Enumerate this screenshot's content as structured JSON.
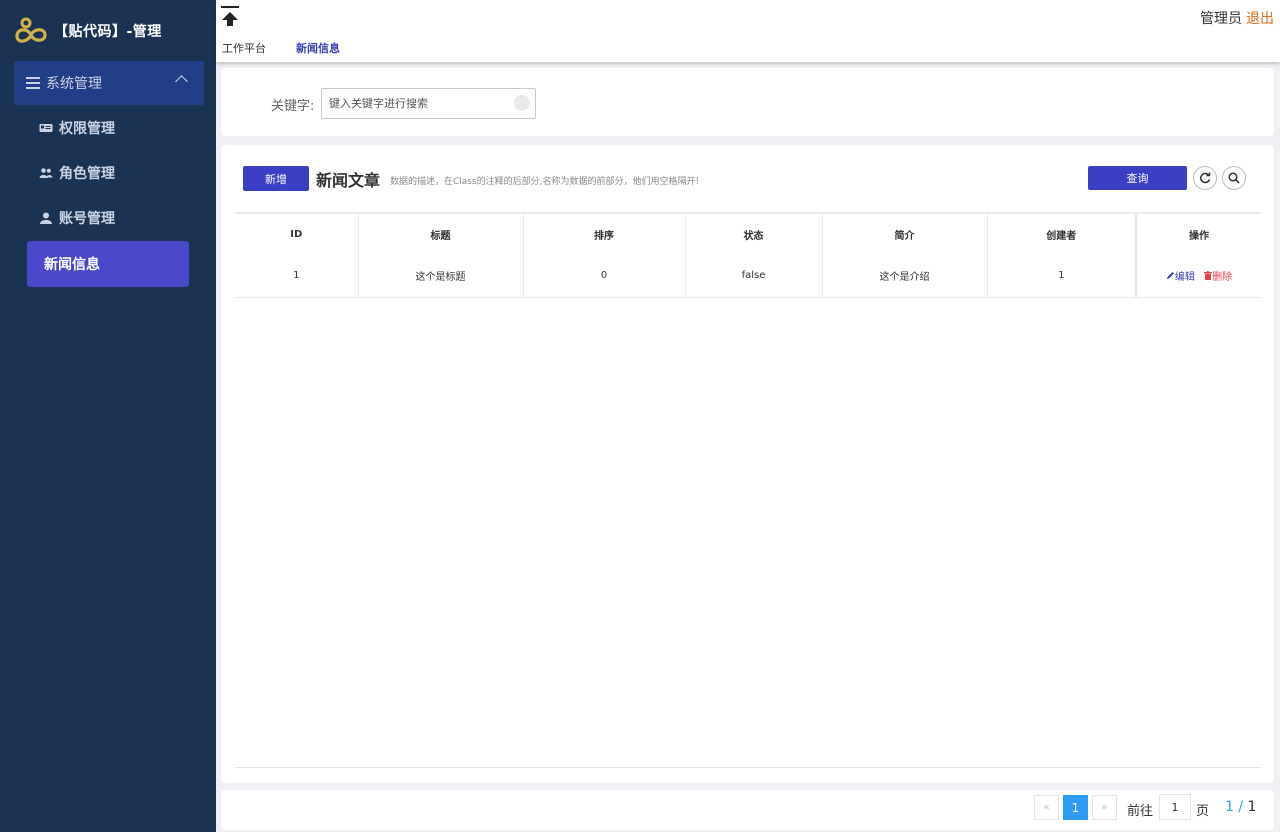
{
  "brand": {
    "title": "【贴代码】-管理"
  },
  "sidebar": {
    "group_label": "系统管理",
    "items": [
      {
        "label": "权限管理",
        "icon": "id-card-icon"
      },
      {
        "label": "角色管理",
        "icon": "users-icon"
      },
      {
        "label": "账号管理",
        "icon": "user-icon"
      },
      {
        "label": "新闻信息",
        "icon": "",
        "active": true
      }
    ]
  },
  "topbar": {
    "user": "管理员",
    "logout": "退出",
    "tabs": [
      "工作平台",
      "新闻信息"
    ]
  },
  "search": {
    "label": "关键字:",
    "placeholder": "键入关键字进行搜索"
  },
  "card": {
    "add_label": "新增",
    "title": "新闻文章",
    "description": "数据的描述，在Class的注释的后部分,名称为数据的前部分，他们用空格隔开!",
    "query_label": "查询"
  },
  "table": {
    "columns": [
      "ID",
      "标题",
      "排序",
      "状态",
      "简介",
      "创建者",
      "操作"
    ],
    "rows": [
      {
        "id": "1",
        "title": "这个是标题",
        "sort": "0",
        "status": "false",
        "intro": "这个是介绍",
        "creator": "1"
      }
    ],
    "edit_label": "编辑",
    "delete_label": "删除"
  },
  "pager": {
    "prev": "«",
    "current": "1",
    "next": "»",
    "goto_label": "前往",
    "goto_value": "1",
    "page_label": "页",
    "page_current": "1",
    "page_total": "1"
  },
  "colors": {
    "sidebar_bg": "#1a3352",
    "accent": "#3b3fc4",
    "active_item": "#4a48c9",
    "pager_active": "#2d9cf5",
    "logout": "#e06c1a",
    "delete": "#e64545"
  }
}
